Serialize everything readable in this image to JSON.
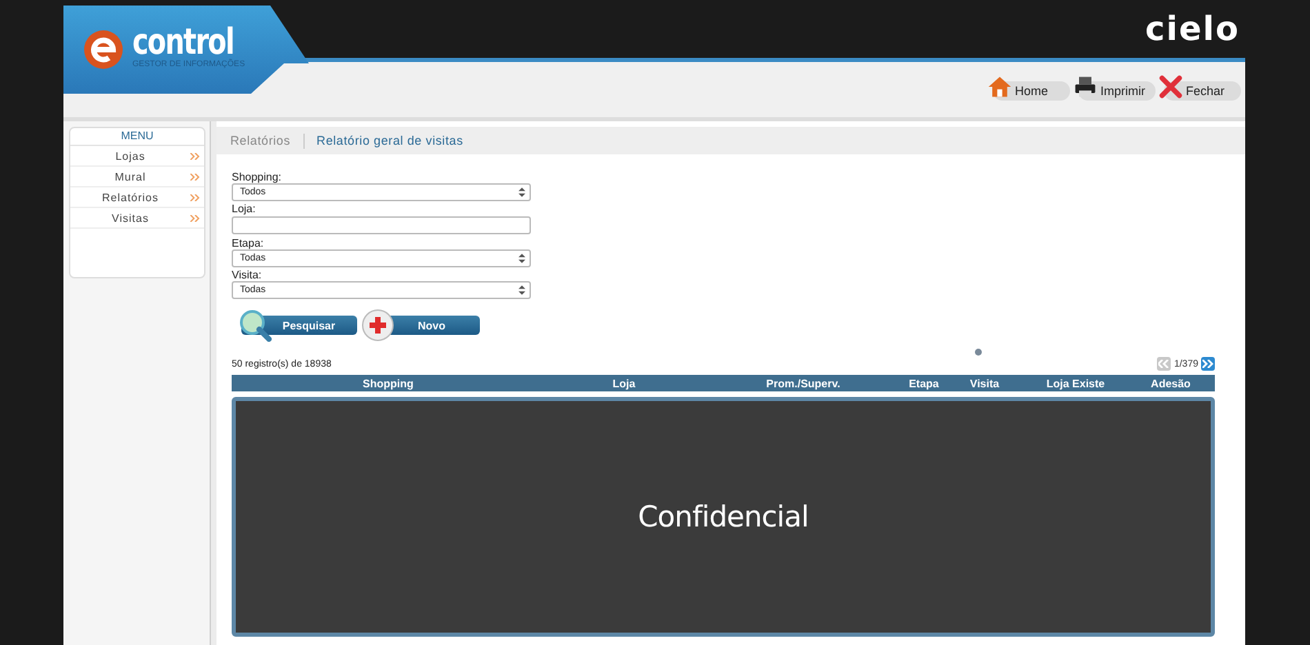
{
  "logo": {
    "name": "control",
    "tagline": "GESTOR DE INFORMAÇÕES"
  },
  "brand": "cielo",
  "toolbar": [
    {
      "kind": "home",
      "label": "Home"
    },
    {
      "kind": "print",
      "label": "Imprimir"
    },
    {
      "kind": "close",
      "label": "Fechar"
    }
  ],
  "sidebar": {
    "title": "MENU",
    "items": [
      "Lojas",
      "Mural",
      "Relatórios",
      "Visitas"
    ]
  },
  "breadcrumb": [
    "Relatórios",
    "Relatório geral de visitas"
  ],
  "filters": [
    {
      "kind": "select",
      "label": "Shopping:",
      "value": "Todos"
    },
    {
      "kind": "text",
      "label": "Loja:"
    },
    {
      "kind": "select",
      "label": "Etapa:",
      "value": "Todas"
    },
    {
      "kind": "select",
      "label": "Visita:",
      "value": "Todas"
    }
  ],
  "actions": [
    {
      "kind": "search",
      "label": "Pesquisar"
    },
    {
      "kind": "new",
      "label": "Novo"
    }
  ],
  "summary": "50 registro(s) de 18938",
  "pager": {
    "page": "1/379",
    "prev_disabled": true
  },
  "table": {
    "columns": [
      "Shopping",
      "Loja",
      "Prom./Superv.",
      "Etapa",
      "Visita",
      "Loja Existe",
      "Adesão"
    ]
  },
  "redaction": {
    "label": "Confidencial"
  }
}
